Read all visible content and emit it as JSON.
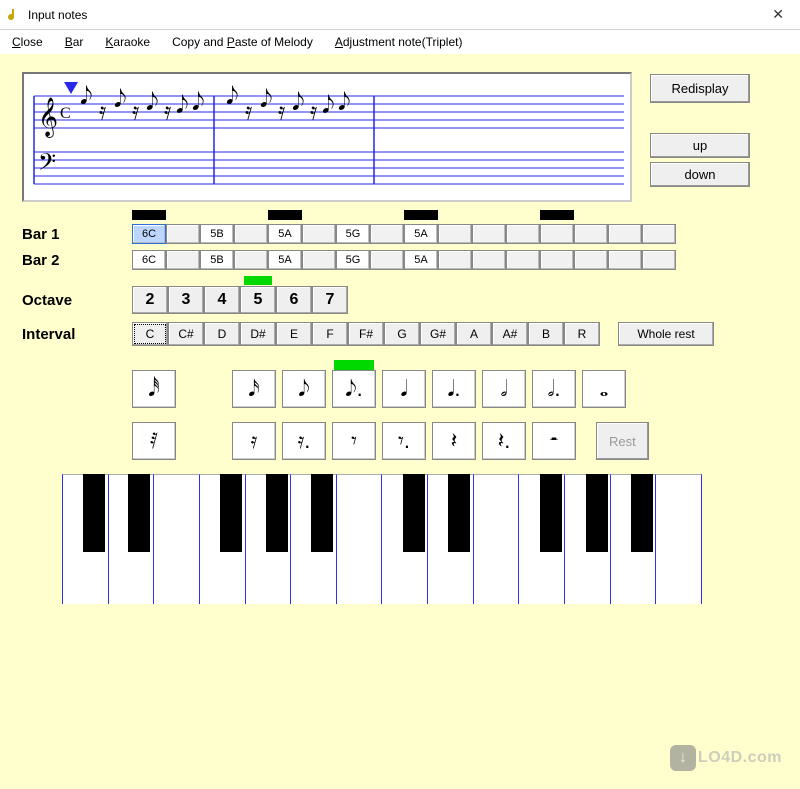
{
  "window": {
    "title": "Input notes"
  },
  "menu": {
    "close": "Close",
    "bar": "Bar",
    "karaoke": "Karaoke",
    "copy_paste": "Copy and Paste of Melody",
    "adjustment": "Adjustment note(Triplet)"
  },
  "buttons": {
    "redisplay": "Redisplay",
    "up": "up",
    "down": "down",
    "rest": "Rest",
    "whole_rest": "Whole rest"
  },
  "labels": {
    "bar1": "Bar 1",
    "bar2": "Bar 2",
    "octave": "Octave",
    "interval": "Interval"
  },
  "bars": {
    "black_marker_indices": [
      0,
      4,
      8,
      12
    ],
    "bar1_cells": [
      "6C",
      "",
      "5B",
      "",
      "5A",
      "",
      "5G",
      "",
      "5A",
      "",
      "",
      "",
      "",
      "",
      "",
      ""
    ],
    "bar2_cells": [
      "6C",
      "",
      "5B",
      "",
      "5A",
      "",
      "5G",
      "",
      "5A",
      "",
      "",
      "",
      "",
      "",
      "",
      ""
    ],
    "bar1_selected_index": 0
  },
  "octave": {
    "values": [
      "2",
      "3",
      "4",
      "5",
      "6",
      "7"
    ],
    "marker_index": 3
  },
  "interval": {
    "values": [
      "C",
      "C#",
      "D",
      "D#",
      "E",
      "F",
      "F#",
      "G",
      "G#",
      "A",
      "A#",
      "B",
      "R"
    ],
    "selected_index": 0
  },
  "durations": {
    "marker_index": 4,
    "row1_glyphs": [
      "𝅘𝅥𝅰",
      "",
      "𝅘𝅥𝅯",
      "𝅘𝅥𝅮",
      "𝅘𝅥𝅮.",
      "𝅘𝅥",
      "𝅘𝅥.",
      "𝅗𝅥",
      "𝅗𝅥.",
      "𝅝"
    ],
    "row2_glyphs": [
      "𝅀",
      "",
      "𝄿",
      "𝄿.",
      "𝄾",
      "𝄾.",
      "𝄽",
      "𝄽.",
      "𝄼"
    ]
  },
  "piano": {
    "white_key_count": 14,
    "black_key_left_percents": [
      5.0,
      12.1,
      26.4,
      33.6,
      40.7,
      55.0,
      62.1,
      76.4,
      83.6,
      90.7
    ]
  },
  "watermark": {
    "badge": "↓",
    "text": "LO4D.com"
  }
}
